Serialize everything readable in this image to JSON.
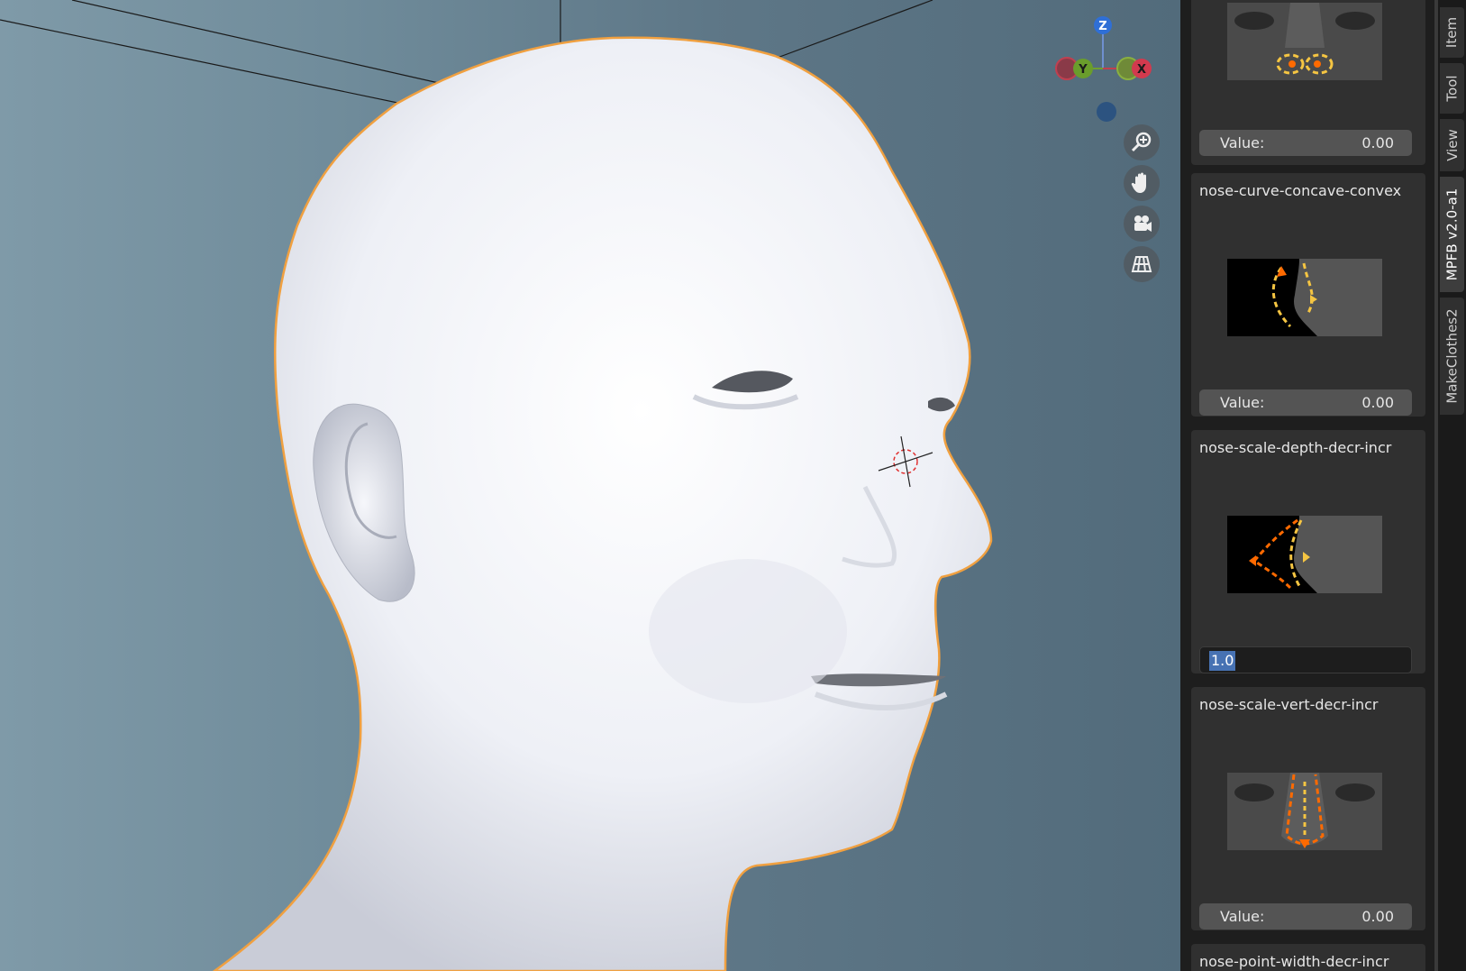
{
  "viewport": {
    "gizmo": {
      "z": "Z",
      "y": "Y",
      "x": "X"
    },
    "nav_buttons": [
      "zoom-icon",
      "hand-pan-icon",
      "camera-icon",
      "grid-view-icon"
    ]
  },
  "npanel": {
    "cards": [
      {
        "title": "",
        "value_label": "Value:",
        "value": "0.00",
        "thumbnail": "nose-nostrils-thumbnail"
      },
      {
        "title": "nose-curve-concave-convex",
        "value_label": "Value:",
        "value": "0.00",
        "thumbnail": "nose-curve-thumbnail"
      },
      {
        "title": "nose-scale-depth-decr-incr",
        "edit_value": "1.0",
        "thumbnail": "nose-depth-thumbnail"
      },
      {
        "title": "nose-scale-vert-decr-incr",
        "value_label": "Value:",
        "value": "0.00",
        "thumbnail": "nose-vert-thumbnail"
      },
      {
        "title": "nose-point-width-decr-incr"
      }
    ]
  },
  "tabs": [
    "Item",
    "Tool",
    "View",
    "MPFB v2.0-a1",
    "MakeClothes2"
  ],
  "active_tab": "MPFB v2.0-a1",
  "colors": {
    "selection_outline": "#f0a040",
    "accent": "#4772b3"
  }
}
